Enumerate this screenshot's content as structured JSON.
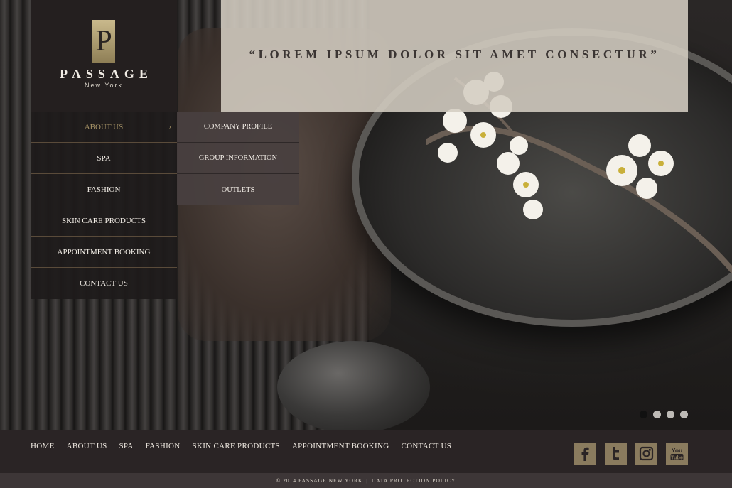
{
  "logo": {
    "mark": "P",
    "name": "PASSAGE",
    "city": "New York"
  },
  "banner": {
    "quote": "“LOREM IPSUM DOLOR SIT AMET CONSECTUR”"
  },
  "main_nav": {
    "items": [
      {
        "label": "ABOUT US",
        "active": true,
        "has_submenu": true
      },
      {
        "label": "SPA"
      },
      {
        "label": "FASHION"
      },
      {
        "label": "SKIN CARE PRODUCTS"
      },
      {
        "label": "APPOINTMENT BOOKING"
      },
      {
        "label": "CONTACT US"
      }
    ],
    "arrow_icon": "chevron-right-icon"
  },
  "submenu": {
    "items": [
      {
        "label": "COMPANY PROFILE"
      },
      {
        "label": "GROUP INFORMATION"
      },
      {
        "label": "OUTLETS"
      }
    ]
  },
  "slider": {
    "dots": 4,
    "active_index": 0
  },
  "footer_nav": {
    "items": [
      {
        "label": "HOME"
      },
      {
        "label": "ABOUT US"
      },
      {
        "label": "SPA"
      },
      {
        "label": "FASHION"
      },
      {
        "label": "SKIN CARE PRODUCTS"
      },
      {
        "label": "APPOINTMENT BOOKING"
      },
      {
        "label": "CONTACT US"
      }
    ]
  },
  "social": {
    "items": [
      {
        "name": "facebook-icon"
      },
      {
        "name": "twitter-icon"
      },
      {
        "name": "instagram-icon"
      },
      {
        "name": "youtube-icon",
        "text": "You Tube"
      }
    ]
  },
  "bottom_bar": {
    "copyright": "© 2014 PASSAGE NEW YORK",
    "separator": "|",
    "policy": "DATA PROTECTION POLICY"
  },
  "colors": {
    "accent": "#a79367",
    "social_bg": "#8a7b5e",
    "banner_bg": "#d4cdc1",
    "footer_bg": "#2a2425"
  }
}
